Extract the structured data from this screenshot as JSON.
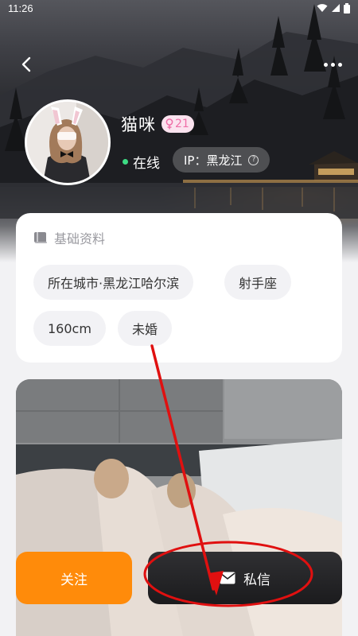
{
  "status_bar": {
    "time": "11:26"
  },
  "profile": {
    "name": "猫咪",
    "age": "21",
    "online_label": "在线",
    "ip_label": "IP：黑龙江"
  },
  "basic_info": {
    "title": "基础资料",
    "tags": [
      {
        "label": "所在城市·黑龙江哈尔滨"
      },
      {
        "label": "射手座"
      },
      {
        "label": "160cm"
      },
      {
        "label": "未婚"
      }
    ]
  },
  "actions": {
    "follow_label": "关注",
    "message_label": "私信"
  },
  "colors": {
    "accent_orange": "#ff8b0a",
    "online_green": "#3ddc84",
    "annotation_red": "#e01010",
    "age_pink": "#ef6fa8"
  }
}
